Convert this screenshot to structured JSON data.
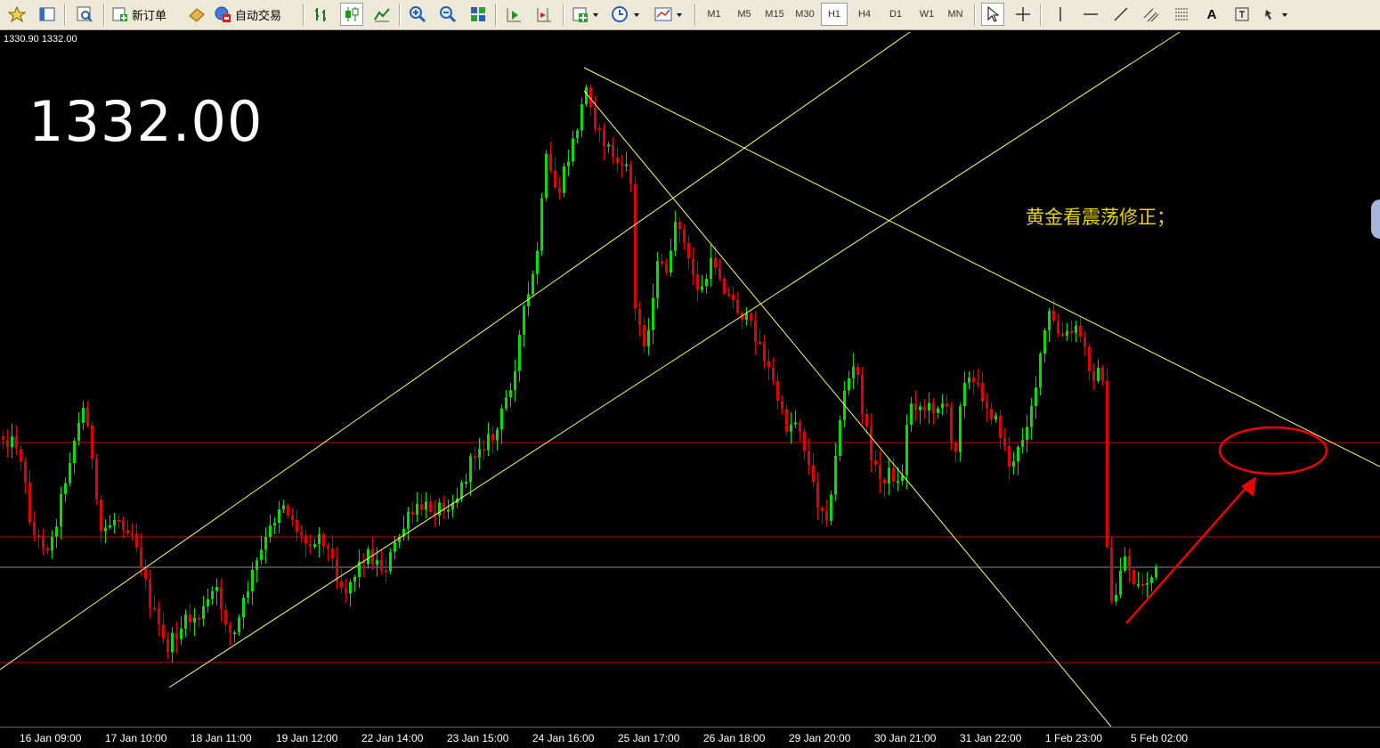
{
  "toolbar": {
    "new_order_label": "新订单",
    "auto_trading_label": "自动交易",
    "timeframes": [
      "M1",
      "M5",
      "M15",
      "M30",
      "H1",
      "H4",
      "D1",
      "W1",
      "MN"
    ],
    "active_timeframe": "H1",
    "text_tool_label": "A"
  },
  "chart": {
    "header_prices": "1330.90 1332.00",
    "current_price": "1332.00",
    "annotation": "黄金看震荡修正；",
    "colors": {
      "background": "#000000",
      "bull": "#00e000",
      "bear": "#e00000",
      "trendline": "#ffff66",
      "level": "#cc0000",
      "arrow": "#ee0000"
    }
  },
  "xaxis": {
    "labels": [
      "16 Jan 09:00",
      "17 Jan 10:00",
      "18 Jan 11:00",
      "19 Jan 12:00",
      "22 Jan 14:00",
      "23 Jan 15:00",
      "24 Jan 16:00",
      "25 Jan 17:00",
      "26 Jan 18:00",
      "29 Jan 20:00",
      "30 Jan 21:00",
      "31 Jan 22:00",
      "1 Feb 23:00",
      "5 Feb 02:00"
    ]
  }
}
